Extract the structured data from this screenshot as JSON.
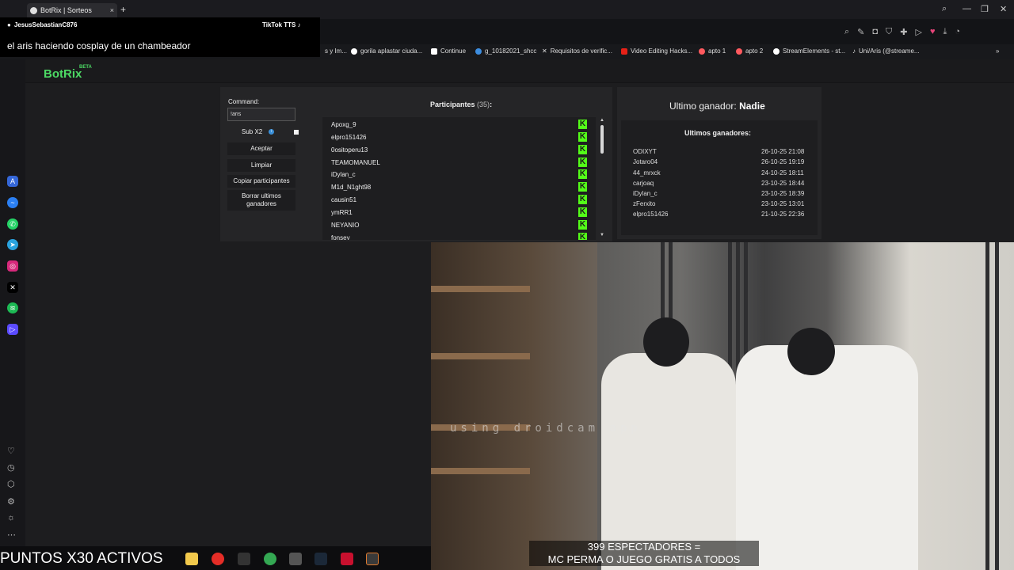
{
  "browser": {
    "tab_title": "BotRix | Sorteos",
    "new_tab": "+",
    "close": "×",
    "bookmarks": [
      "s y Im...",
      "gorila aplastar ciuda...",
      "Continue",
      "g_10182021_shcc",
      "Requisitos de verific...",
      "Video Editing Hacks...",
      "apto 1",
      "apto 2",
      "StreamElements - st...",
      "Uni/Aris (@streame..."
    ],
    "more_bookmarks": "»"
  },
  "tts": {
    "username": "JesusSebastianC876",
    "brand": "TikTok TTS",
    "message": "el aris haciendo cosplay de un chambeador"
  },
  "botrix": {
    "logo": "BotRix",
    "beta": "BETA",
    "command_label": "Command:",
    "command_value": "!aris",
    "sub_label": "Sub X2",
    "info": "i",
    "buttons": {
      "accept": "Aceptar",
      "clear": "Limpiar",
      "copy": "Copiar participantes",
      "delete": "Borrar ultimos ganadores"
    },
    "participants_title": "Participantes",
    "participants_count": "(35)",
    "participants_colon": ":",
    "participants": [
      "Apoxg_9",
      "elpro151426",
      "0ositoperu13",
      "TEAMOMANUEL",
      "iDylan_c",
      "M1d_N1ght98",
      "causin51",
      "ymRR1",
      "NEYANIO",
      "fonsey"
    ],
    "kick_letter": "K",
    "winner_label": "Ultimo ganador:",
    "winner_value": "Nadie",
    "winners_title": "Ultimos ganadores:",
    "winners": [
      {
        "name": "ODIXYT",
        "date": "26-10-25 21:08"
      },
      {
        "name": "Jotaro04",
        "date": "26-10-25 19:19"
      },
      {
        "name": "44_mrxck",
        "date": "24-10-25 18:11"
      },
      {
        "name": "carjoaq",
        "date": "23-10-25 18:44"
      },
      {
        "name": "iDylan_c",
        "date": "23-10-25 18:39"
      },
      {
        "name": "zFerxito",
        "date": "23-10-25 13:01"
      },
      {
        "name": "elpro151426",
        "date": "21-10-25 22:36"
      }
    ]
  },
  "stream": {
    "watermark": "using droidcam app",
    "viewers_line1": "399 ESPECTADORES =",
    "viewers_line2": "MC PERMA O JUEGO GRATIS A TODOS",
    "puntos": "PUNTOS X30 ACTIVOS"
  },
  "colors": {
    "accent_green": "#53fc18",
    "botrix_green": "#4cd964"
  }
}
